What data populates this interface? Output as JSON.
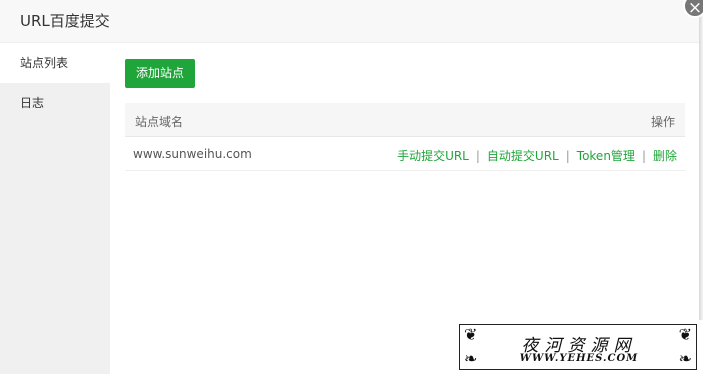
{
  "dialog": {
    "title": "URL百度提交",
    "close_icon": "close-icon"
  },
  "sidebar": {
    "items": [
      {
        "label": "站点列表",
        "active": true
      },
      {
        "label": "日志",
        "active": false
      }
    ]
  },
  "main": {
    "add_button_label": "添加站点",
    "table": {
      "headers": {
        "domain": "站点域名",
        "ops": "操作"
      },
      "rows": [
        {
          "domain": "www.sunweihu.com",
          "ops": [
            "手动提交URL",
            "自动提交URL",
            "Token管理",
            "删除"
          ]
        }
      ]
    }
  },
  "watermark": {
    "title": "夜河资源网",
    "url": "WWW.YEHES.COM"
  },
  "colors": {
    "accent": "#20a53a",
    "sidebar_bg": "#f0f0f0",
    "header_bg": "#f8f8f8"
  }
}
